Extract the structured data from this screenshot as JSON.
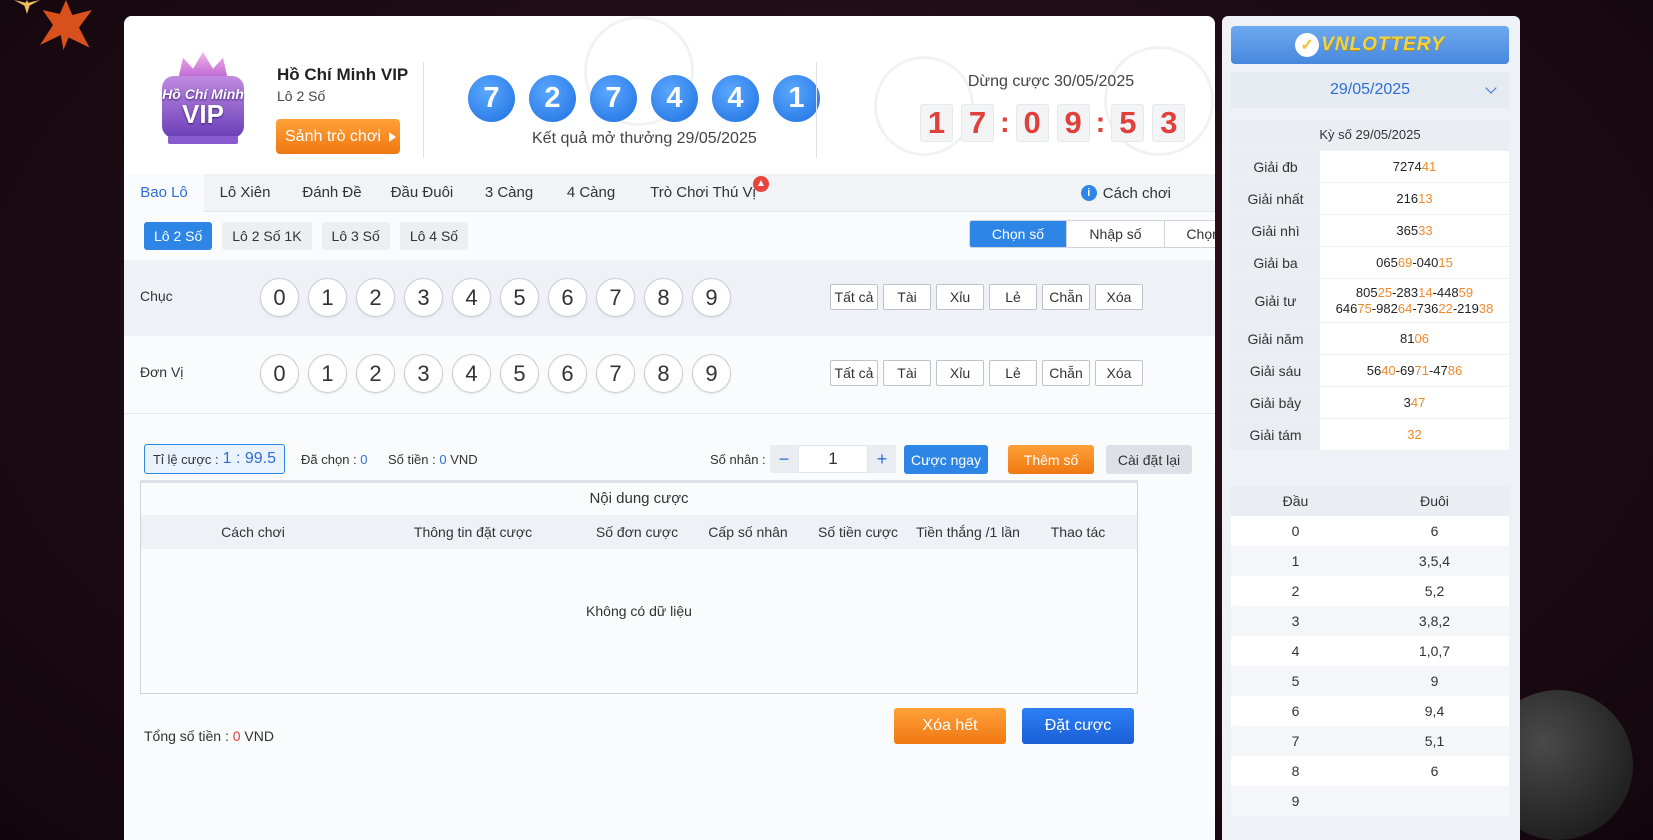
{
  "game": {
    "title": "Hồ Chí Minh VIP",
    "subtitle": "Lô 2 Số",
    "hall_button": "Sảnh trò chơi",
    "logo_line1": "Hồ Chí Minh",
    "logo_line2": "VIP",
    "result_balls": [
      "7",
      "2",
      "7",
      "4",
      "4",
      "1"
    ],
    "result_text": "Kết quả mở thưởng 29/05/2025",
    "stop_text": "Dừng cược 30/05/2025",
    "countdown": [
      "1",
      "7",
      "0",
      "9",
      "5",
      "3"
    ]
  },
  "tabs": [
    "Bao Lô",
    "Lô Xiên",
    "Đánh Đề",
    "Đầu Đuôi",
    "3 Càng",
    "4 Càng",
    "Trò Chơi Thú Vị"
  ],
  "active_tab": "Bao Lô",
  "how_to_play": "Cách chơi",
  "subtabs": [
    "Lô 2 Số",
    "Lô 2 Số 1K",
    "Lô 3 Số",
    "Lô 4 Số"
  ],
  "modes": [
    "Chọn số",
    "Nhập số",
    "Chọn số nhanh"
  ],
  "rows": [
    {
      "label": "Chục"
    },
    {
      "label": "Đơn Vị"
    }
  ],
  "digits": [
    "0",
    "1",
    "2",
    "3",
    "4",
    "5",
    "6",
    "7",
    "8",
    "9"
  ],
  "quick_buttons": [
    "Tất cả",
    "Tài",
    "Xỉu",
    "Lẻ",
    "Chẵn",
    "Xóa"
  ],
  "betbar": {
    "ratio_label": "Tỉ lệ cược :",
    "ratio_value": "1 : 99.5",
    "chosen_label": "Đã chọn :",
    "chosen_value": "0",
    "money_label": "Số tiền :",
    "money_value": "0",
    "money_unit": "VND",
    "multiplier_label": "Số nhân :",
    "multiplier_value": "1",
    "minus": "−",
    "plus": "+",
    "bet_now": "Cược ngay",
    "add_number": "Thêm số",
    "reset": "Cài đặt lại"
  },
  "bet_table": {
    "title": "Nội dung cược",
    "columns": [
      "Cách chơi",
      "Thông tin đặt cược",
      "Số đơn cược",
      "Cấp số nhân",
      "Số tiền cược",
      "Tiền thắng /1 lần",
      "Thao tác"
    ],
    "empty": "Không có dữ liệu"
  },
  "footer": {
    "total_label": "Tổng số tiền :",
    "total_value": "0",
    "total_unit": "VND",
    "clear_all": "Xóa hết",
    "place_bet": "Đặt cược"
  },
  "sidebar": {
    "brand": "VNLOTTERY",
    "date": "29/05/2025",
    "draw_title": "Kỳ số 29/05/2025",
    "prizes": [
      {
        "name": "Giải đb",
        "lines": [
          [
            [
              "7274",
              ""
            ],
            [
              "41",
              "hl"
            ]
          ]
        ]
      },
      {
        "name": "Giải nhất",
        "lines": [
          [
            [
              "216",
              ""
            ],
            [
              "13",
              "hl"
            ]
          ]
        ]
      },
      {
        "name": "Giải nhì",
        "lines": [
          [
            [
              "365",
              ""
            ],
            [
              "33",
              "hl"
            ]
          ]
        ]
      },
      {
        "name": "Giải ba",
        "lines": [
          [
            [
              "065",
              ""
            ],
            [
              "69",
              "hl"
            ],
            [
              "-040",
              ""
            ],
            [
              "15",
              "hl"
            ]
          ]
        ]
      },
      {
        "name": "Giải tư",
        "lines": [
          [
            [
              "805",
              ""
            ],
            [
              "25",
              "hl"
            ],
            [
              "-283",
              ""
            ],
            [
              "14",
              "hl"
            ],
            [
              "-448",
              ""
            ],
            [
              "59",
              "hl"
            ]
          ],
          [
            [
              "646",
              ""
            ],
            [
              "75",
              "hl"
            ],
            [
              "-982",
              ""
            ],
            [
              "64",
              "hl"
            ],
            [
              "-736",
              ""
            ],
            [
              "22",
              "hl"
            ],
            [
              "-219",
              ""
            ],
            [
              "38",
              "hl"
            ]
          ]
        ]
      },
      {
        "name": "Giải năm",
        "lines": [
          [
            [
              "81",
              ""
            ],
            [
              "06",
              "hl"
            ]
          ]
        ]
      },
      {
        "name": "Giải sáu",
        "lines": [
          [
            [
              "56",
              ""
            ],
            [
              "40",
              "hl"
            ],
            [
              "-69",
              ""
            ],
            [
              "71",
              "hl"
            ],
            [
              "-47",
              ""
            ],
            [
              "86",
              "hl"
            ]
          ]
        ]
      },
      {
        "name": "Giải bảy",
        "lines": [
          [
            [
              "3",
              ""
            ],
            [
              "47",
              "hl"
            ]
          ]
        ]
      },
      {
        "name": "Giải tám",
        "lines": [
          [
            [
              "32",
              "hl"
            ]
          ]
        ]
      }
    ],
    "dd_head": [
      "Đầu",
      "Đuôi"
    ],
    "dd_rows": [
      [
        "0",
        "6"
      ],
      [
        "1",
        "3,5,4"
      ],
      [
        "2",
        "5,2"
      ],
      [
        "3",
        "3,8,2"
      ],
      [
        "4",
        "1,0,7"
      ],
      [
        "5",
        "9"
      ],
      [
        "6",
        "9,4"
      ],
      [
        "7",
        "5,1"
      ],
      [
        "8",
        "6"
      ],
      [
        "9",
        ""
      ]
    ]
  },
  "colors": {
    "accent": "#2d86e6",
    "countdown": "#e0413a",
    "highlight": "#ef8a2a",
    "orange_button": "#f07812"
  }
}
